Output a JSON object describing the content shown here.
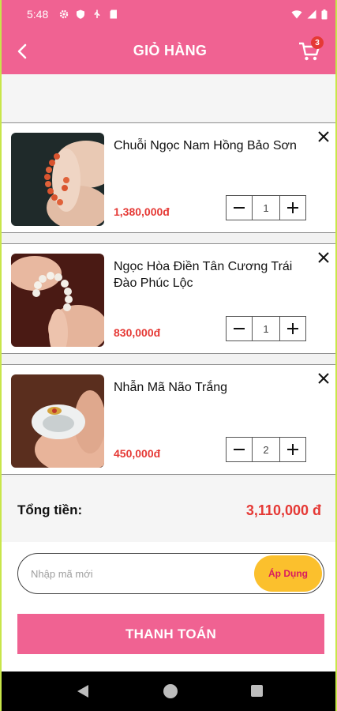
{
  "status_bar": {
    "time": "5:48"
  },
  "header": {
    "title": "GIỎ HÀNG",
    "cart_badge": "3"
  },
  "cart_items": [
    {
      "name": "Chuỗi Ngọc Nam Hồng Bảo Sơn",
      "price": "1,380,000đ",
      "quantity": "1",
      "image": "coral-bead-bracelet-photo"
    },
    {
      "name": "Ngọc Hòa Điền Tân Cương Trái Đào Phúc Lộc",
      "price": "830,000đ",
      "quantity": "1",
      "image": "white-jade-bead-bracelet-photo"
    },
    {
      "name": "Nhẫn Mã Não Trắng",
      "price": "450,000đ",
      "quantity": "2",
      "image": "white-agate-ring-photo"
    }
  ],
  "summary": {
    "total_label": "Tổng tiền:",
    "total_value": "3,110,000 đ"
  },
  "coupon": {
    "placeholder": "Nhập mã mới",
    "apply_label": "Áp Dụng"
  },
  "checkout": {
    "label": "THANH TOÁN"
  },
  "colors": {
    "primary": "#f06292",
    "price": "#e53935",
    "apply_button": "#fbc02d"
  },
  "icons": {
    "back": "chevron-left-icon",
    "cart": "shopping-cart-icon",
    "remove": "close-icon",
    "decrease": "minus-icon",
    "increase": "plus-icon"
  }
}
